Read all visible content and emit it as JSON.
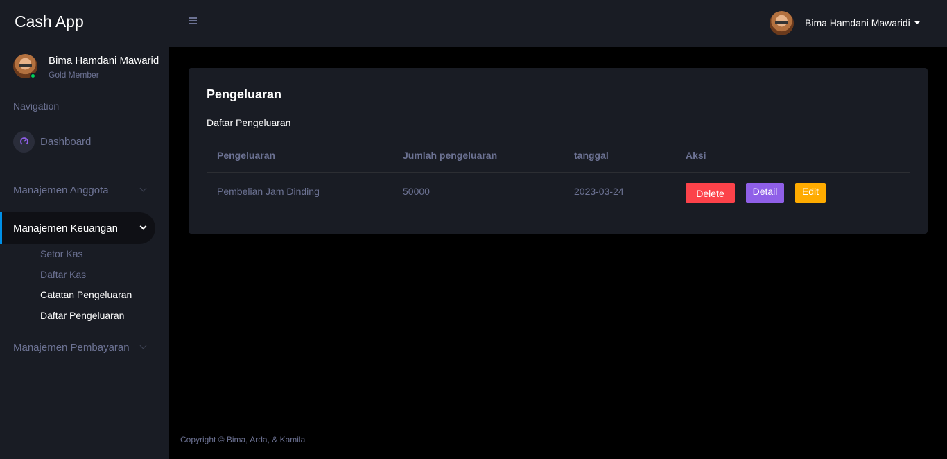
{
  "brand": "Cash App",
  "user": {
    "name": "Bima Hamdani Mawaridi",
    "sidebar_name": "Bima Hamdani Mawarid",
    "role": "Gold Member",
    "status_color": "#00d25b"
  },
  "sidebar": {
    "category": "Navigation",
    "items": [
      {
        "label": "Dashboard",
        "icon": "speedometer-icon"
      },
      {
        "label": "Manajemen Anggota",
        "icon": "chevron-down-icon"
      },
      {
        "label": "Manajemen Keuangan",
        "icon": "chevron-down-icon",
        "active": true
      },
      {
        "label": "Manajemen Pembayaran",
        "icon": "chevron-down-icon"
      }
    ],
    "subitems": [
      "Setor Kas",
      "Daftar Kas",
      "Catatan Pengeluaran",
      "Daftar Pengeluaran"
    ]
  },
  "card": {
    "title": "Pengeluaran",
    "description": "Daftar Pengeluaran",
    "columns": [
      "Pengeluaran",
      "Jumlah pengeluaran",
      "tanggal",
      "Aksi"
    ],
    "rows": [
      {
        "pengeluaran": "Pembelian Jam Dinding",
        "jumlah": "50000",
        "tanggal": "2023-03-24"
      }
    ],
    "actions": {
      "delete": "Delete",
      "detail": "Detail",
      "edit": "Edit"
    }
  },
  "footer": "Copyright © Bima, Arda, & Kamila",
  "colors": {
    "accent": "#0090e7",
    "danger": "#fc424a",
    "primary": "#8f5fe8",
    "warning": "#ffab00"
  }
}
